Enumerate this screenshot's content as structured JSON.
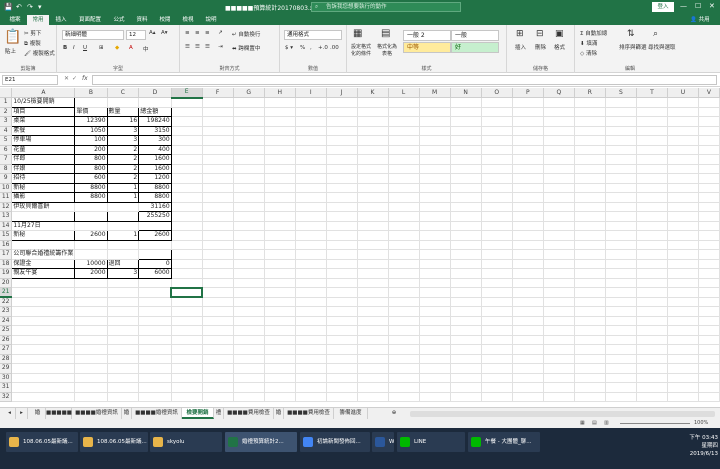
{
  "titlebar": {
    "title": "■■■■■預算統計20170803.xls [相容模式] - Excel",
    "search_placeholder": "告訴我您想要執行的動作",
    "login": "登入",
    "win_min": "—",
    "win_max": "☐",
    "win_close": "✕"
  },
  "tabs": [
    "檔案",
    "常用",
    "插入",
    "頁面配置",
    "公式",
    "資料",
    "校閱",
    "檢視",
    "說明"
  ],
  "share": "共用",
  "ribbon": {
    "clipboard": {
      "name": "剪貼簿",
      "paste": "貼上",
      "cut": "剪下",
      "copy": "複製",
      "format_painter": "複製格式"
    },
    "font": {
      "name": "字型",
      "family": "新細明體",
      "size": "12"
    },
    "alignment": {
      "name": "對齊方式",
      "wrap": "自動換行",
      "merge": "跨欄置中"
    },
    "number": {
      "name": "數值",
      "format": "通用格式"
    },
    "styles": {
      "name": "樣式",
      "conditional": "設定格式化的條件",
      "table": "格式化為表格",
      "normal2": "一般 2",
      "normal": "一般",
      "neutral": "中等",
      "good": "好"
    },
    "cells": {
      "name": "儲存格",
      "insert": "插入",
      "delete": "刪除",
      "format": "格式"
    },
    "editing": {
      "name": "編輯",
      "autosum": "自動加總",
      "fill": "填滿",
      "clear": "清除",
      "sort": "排序與篩選",
      "find": "尋找與選取"
    }
  },
  "namebox": "E21",
  "columns": [
    "A",
    "B",
    "C",
    "D",
    "E",
    "F",
    "G",
    "H",
    "I",
    "J",
    "K",
    "L",
    "M",
    "N",
    "O",
    "P",
    "Q",
    "R",
    "S",
    "T",
    "U",
    "V"
  ],
  "rows": [
    {
      "n": "1",
      "a": "10/25檢要開銷",
      "b": "",
      "c": "",
      "d": ""
    },
    {
      "n": "2",
      "a": "項目",
      "b": "單價",
      "c": "數量",
      "d": "總金額"
    },
    {
      "n": "3",
      "a": "桌菜",
      "b": "12390",
      "c": "16",
      "d": "198240"
    },
    {
      "n": "4",
      "a": "素餐",
      "b": "1050",
      "c": "3",
      "d": "3150"
    },
    {
      "n": "5",
      "a": "停車場",
      "b": "100",
      "c": "3",
      "d": "300"
    },
    {
      "n": "6",
      "a": "花童",
      "b": "200",
      "c": "2",
      "d": "400"
    },
    {
      "n": "7",
      "a": "伴郎",
      "b": "800",
      "c": "2",
      "d": "1600"
    },
    {
      "n": "8",
      "a": "伴娘",
      "b": "800",
      "c": "2",
      "d": "1600"
    },
    {
      "n": "9",
      "a": "招待",
      "b": "600",
      "c": "2",
      "d": "1200"
    },
    {
      "n": "10",
      "a": "新秘",
      "b": "8800",
      "c": "1",
      "d": "8800"
    },
    {
      "n": "11",
      "a": "攝影",
      "b": "8800",
      "c": "1",
      "d": "8800"
    },
    {
      "n": "12",
      "a": "伊玫貝爾喜餅",
      "b": "",
      "c": "",
      "d": "31160"
    },
    {
      "n": "13",
      "a": "",
      "b": "",
      "c": "",
      "d": "255250"
    },
    {
      "n": "14",
      "a": "   11月27日",
      "b": "",
      "c": "",
      "d": ""
    },
    {
      "n": "15",
      "a": "新秘",
      "b": "2600",
      "c": "1",
      "d": "2600"
    },
    {
      "n": "16",
      "a": "",
      "b": "",
      "c": "",
      "d": ""
    },
    {
      "n": "17",
      "a": "公司聯合婚禮統籌作業",
      "b": "",
      "c": "",
      "d": ""
    },
    {
      "n": "18",
      "a": "保證金",
      "b": "10000",
      "c": "退回",
      "d": "0"
    },
    {
      "n": "19",
      "a": "親友午宴",
      "b": "2000",
      "c": "3",
      "d": "6000"
    },
    {
      "n": "20",
      "a": "",
      "b": "",
      "c": "",
      "d": ""
    },
    {
      "n": "21",
      "a": "",
      "b": "",
      "c": "",
      "d": ""
    },
    {
      "n": "22",
      "a": "",
      "b": "",
      "c": "",
      "d": ""
    },
    {
      "n": "23",
      "a": "",
      "b": "",
      "c": "",
      "d": ""
    },
    {
      "n": "24",
      "a": "",
      "b": "",
      "c": "",
      "d": ""
    },
    {
      "n": "25",
      "a": "",
      "b": "",
      "c": "",
      "d": ""
    },
    {
      "n": "26",
      "a": "",
      "b": "",
      "c": "",
      "d": ""
    },
    {
      "n": "27",
      "a": "",
      "b": "",
      "c": "",
      "d": ""
    },
    {
      "n": "28",
      "a": "",
      "b": "",
      "c": "",
      "d": ""
    },
    {
      "n": "29",
      "a": "",
      "b": "",
      "c": "",
      "d": ""
    },
    {
      "n": "30",
      "a": "",
      "b": "",
      "c": "",
      "d": ""
    },
    {
      "n": "31",
      "a": "",
      "b": "",
      "c": "",
      "d": ""
    },
    {
      "n": "32",
      "a": "",
      "b": "",
      "c": "",
      "d": ""
    }
  ],
  "sheet_tabs": [
    "婚",
    "■■■■■",
    "■■■■婚禮資訊",
    "婚",
    "■■■■婚禮資訊",
    "檢要開銷",
    "禮",
    "■■■■費用檢查",
    "婚",
    "■■■■費用檢查",
    "籌備進度"
  ],
  "status": {
    "zoom": "100%"
  },
  "taskbar": [
    {
      "label": "108.06.05最新議...",
      "color": "#e8b54a"
    },
    {
      "label": "108.06.05最新議...",
      "color": "#e8b54a"
    },
    {
      "label": "skyolu",
      "color": "#e8b54a"
    },
    {
      "label": "婚禮預算統計2...",
      "color": "#217346"
    },
    {
      "label": "初論新聞發佈回...",
      "color": "#4285f4"
    },
    {
      "label": "W",
      "color": "#2b579a"
    },
    {
      "label": "LINE",
      "color": "#00b900"
    },
    {
      "label": "午餐 - 大團體_聊...",
      "color": "#00b900"
    }
  ],
  "clock": {
    "time": "下午 03:43",
    "day": "星期四",
    "date": "2019/6/13"
  }
}
